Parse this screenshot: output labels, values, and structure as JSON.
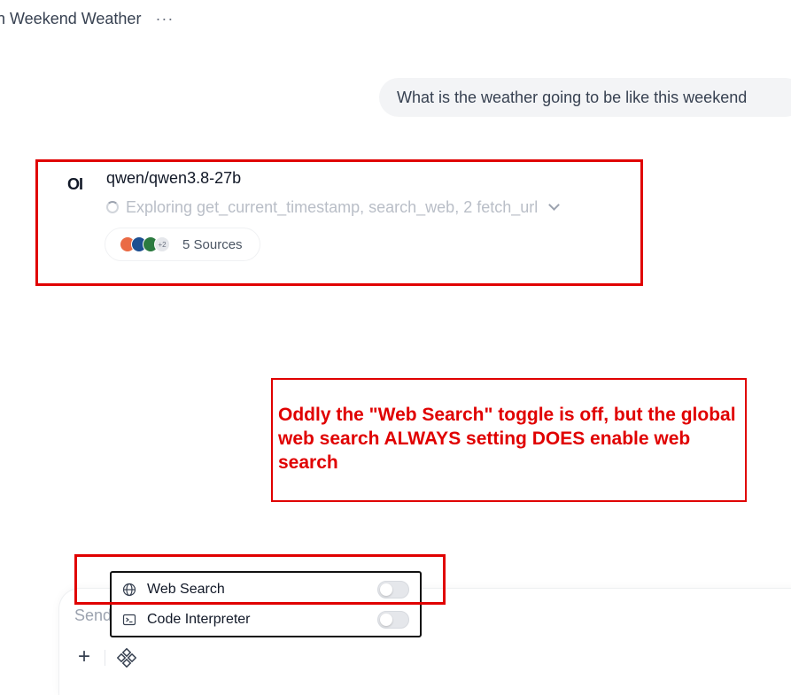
{
  "header": {
    "title": "n Weekend Weather",
    "more_label": "···"
  },
  "user_message": {
    "text": "What is the weather going to be like this weekend"
  },
  "assistant": {
    "avatar_text": "OI",
    "model_name": "qwen/qwen3.8-27b",
    "status_text": "Exploring get_current_timestamp, search_web, 2 fetch_url",
    "sources": {
      "more_count": "+2",
      "label": "5 Sources"
    }
  },
  "annotation": {
    "text": "Oddly the \"Web Search\" toggle is off, but the global web search ALWAYS setting DOES enable web search",
    "color": "#e00000"
  },
  "composer": {
    "placeholder": "Send",
    "plus_label": "+"
  },
  "tools_menu": {
    "items": [
      {
        "label": "Web Search",
        "icon": "globe-icon",
        "enabled": false
      },
      {
        "label": "Code Interpreter",
        "icon": "terminal-icon",
        "enabled": false
      }
    ]
  }
}
